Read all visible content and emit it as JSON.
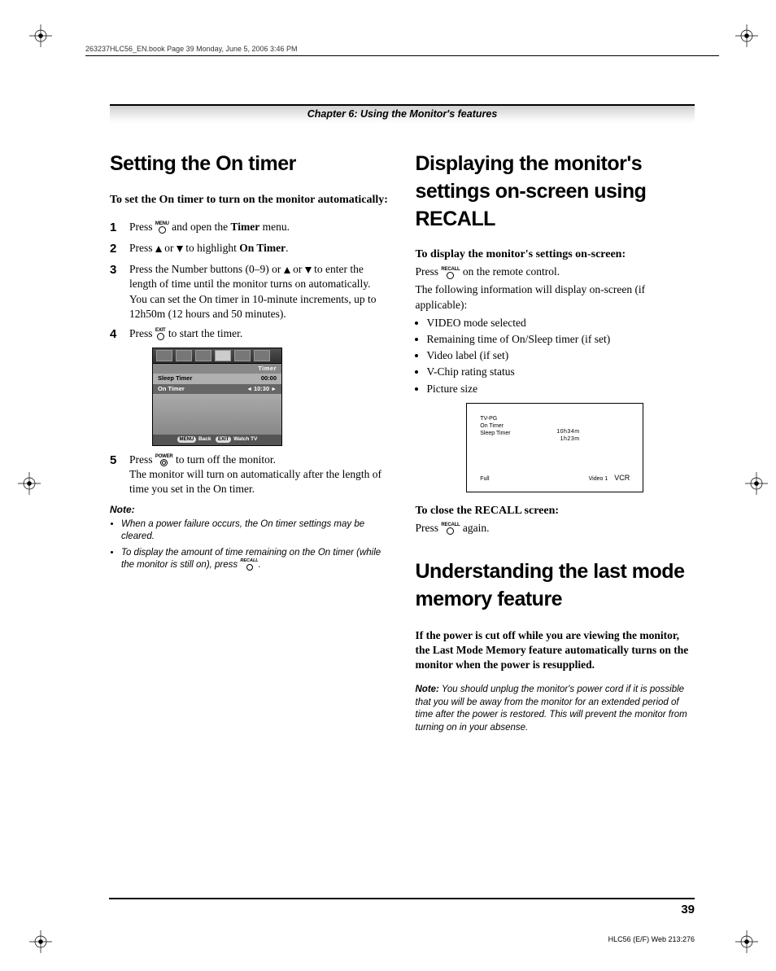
{
  "header": {
    "book_line": "263237HLC56_EN.book  Page 39  Monday, June 5, 2006  3:46 PM",
    "chapter": "Chapter 6: Using the Monitor's features"
  },
  "left": {
    "h1": "Setting the On timer",
    "lead": "To set the On timer to turn on the monitor automatically:",
    "steps": {
      "s1_a": "Press ",
      "s1_menu": "MENU",
      "s1_b": " and open the ",
      "s1_timer": "Timer",
      "s1_c": " menu.",
      "s2_a": "Press ",
      "s2_b": " or ",
      "s2_c": " to highlight ",
      "s2_on": "On Timer",
      "s2_d": ".",
      "s3_a": "Press the Number buttons (0–9) or ",
      "s3_b": " or ",
      "s3_c": " to enter the length of time until the monitor turns on automatically. You can set the On timer in 10-minute increments, up to 12h50m (12 hours and 50 minutes).",
      "s4_a": "Press ",
      "s4_exit": "EXIT",
      "s4_b": " to start the timer.",
      "s5_a": "Press ",
      "s5_pwr": "POWER",
      "s5_b": " to turn off the monitor.",
      "s5_c": "The monitor will turn on automatically after the length of time you set in the On timer."
    },
    "menu": {
      "hdr": "Timer",
      "row1_l": "Sleep Timer",
      "row1_r": "00:00",
      "row2_l": "On Timer",
      "row2_r": "10:30",
      "foot_menu": "MENU",
      "foot_back": " Back",
      "foot_exit": "EXIT",
      "foot_watch": " Watch TV"
    },
    "note_head": "Note:",
    "notes": {
      "n1": "When a power failure occurs, the On timer settings may be cleared.",
      "n2_a": "To display the amount of time remaining on the On timer (while the monitor is still on), press ",
      "n2_recall": "RECALL",
      "n2_b": "."
    }
  },
  "right": {
    "h1a": "Displaying the monitor's settings on-screen using RECALL",
    "sub1": "To display the monitor's settings on-screen:",
    "p1_a": "Press ",
    "p1_recall": "RECALL",
    "p1_b": " on the remote control.",
    "p2": "The following information will display on-screen (if applicable):",
    "bullets": {
      "b1": "VIDEO mode selected",
      "b2": "Remaining time of On/Sleep timer (if set)",
      "b3": "Video label (if set)",
      "b4": "V-Chip rating status",
      "b5": "Picture size"
    },
    "recall": {
      "tvpg": "TV-PG",
      "on": "On Timer",
      "sleep": "Sleep Timer",
      "on_v": "10h34m",
      "sleep_v": "1h23m",
      "full": "Full",
      "video1": "Video 1",
      "vcr": "VCR"
    },
    "sub2": "To close the RECALL screen:",
    "p3_a": "Press ",
    "p3_b": " again.",
    "h1b": "Understanding the last mode memory feature",
    "bold_para": "If the power is cut off while you are viewing the monitor, the Last Mode Memory feature automatically turns on the monitor when the power is resupplied.",
    "note2_label": "Note:",
    "note2": " You should unplug the monitor's power cord if it is possible that you will be away from the monitor for an extended period of time after the power is restored. This will prevent the monitor from turning on in your absense."
  },
  "footer": {
    "page": "39",
    "code": "HLC56 (E/F) Web 213:276"
  }
}
